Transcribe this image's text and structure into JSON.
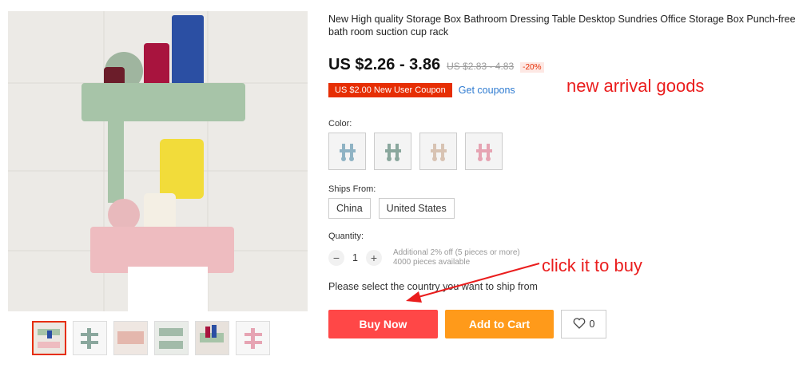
{
  "product": {
    "title": "New High quality Storage Box Bathroom Dressing Table Desktop Sundries Office Storage Box Punch-free bath room suction cup rack",
    "price": "US $2.26 - 3.86",
    "original_price": "US $2.83 - 4.83",
    "discount": "-20%"
  },
  "coupon": {
    "label": "US $2.00 New User Coupon",
    "link": "Get coupons"
  },
  "annotations": {
    "new_arrival": "new arrival goods",
    "click_to_buy": "click it to buy"
  },
  "color": {
    "label": "Color:",
    "swatches": [
      {
        "name": "blue",
        "hex": "#8fb3c4"
      },
      {
        "name": "green",
        "hex": "#8aa79d"
      },
      {
        "name": "beige",
        "hex": "#d8c3b3"
      },
      {
        "name": "pink",
        "hex": "#e6a4b3"
      }
    ]
  },
  "ships_from": {
    "label": "Ships From:",
    "options": [
      "China",
      "United States"
    ]
  },
  "quantity": {
    "label": "Quantity:",
    "minus": "−",
    "value": "1",
    "plus": "+",
    "bulk_discount": "Additional 2% off (5 pieces or more)",
    "available": "4000 pieces available"
  },
  "ship_country_text": "Please select the country you want to ship from",
  "actions": {
    "buy_now": "Buy Now",
    "add_to_cart": "Add to Cart",
    "wishlist_count": "0"
  },
  "colors": {
    "accent_red": "#ff4747",
    "accent_orange": "#ff9a1a",
    "coupon_red": "#e62e04",
    "link_blue": "#2e7bd1",
    "annotation_red": "#ea1d1d"
  }
}
